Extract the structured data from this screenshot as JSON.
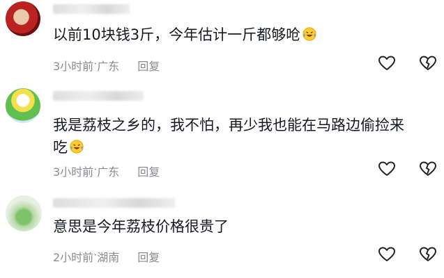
{
  "comments": [
    {
      "text": "以前10块钱3斤，今年估计一斤都够呛",
      "time": "3小时前",
      "location": "广东",
      "reply": "回复"
    },
    {
      "text_line1": "我是荔枝之乡的，我不怕，再少我也能在马路边偷捡来",
      "text_line2": "吃",
      "time": "3小时前",
      "location": "广东",
      "reply": "回复"
    },
    {
      "text": "意思是今年荔枝价格很贵了",
      "time": "2小时前",
      "location": "湖南",
      "reply": "回复"
    }
  ],
  "separator": " · ",
  "icons": [
    "heart-outline-icon",
    "broken-heart-icon",
    "laughing-tears-emoji-icon"
  ],
  "colors": {
    "text": "#161823",
    "meta": "#8a8b91",
    "icon": "#222222"
  }
}
